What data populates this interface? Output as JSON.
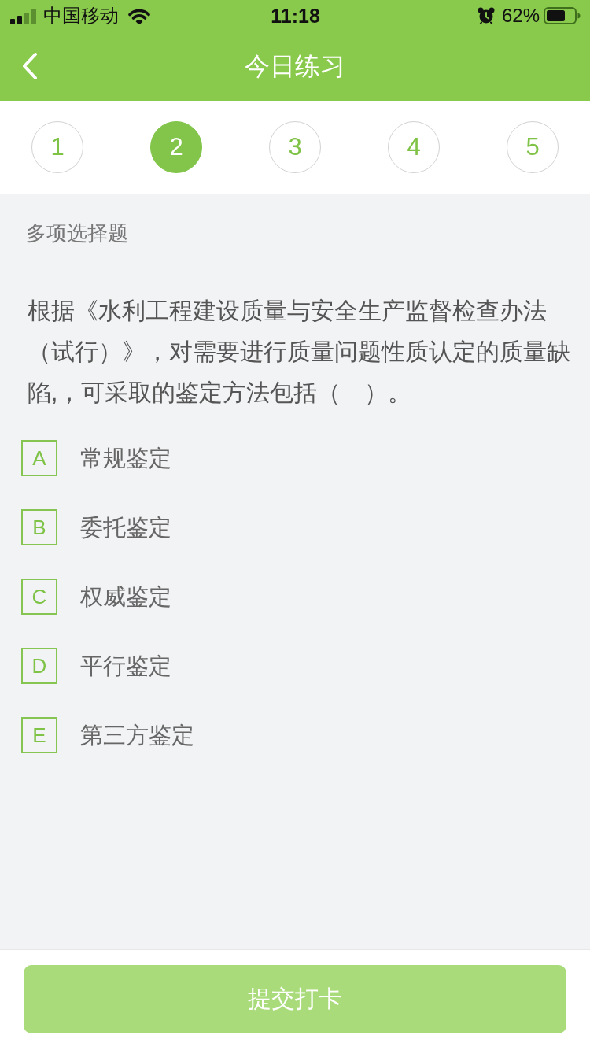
{
  "status_bar": {
    "carrier": "中国移动",
    "time": "11:18",
    "battery_percent": "62%"
  },
  "nav_bar": {
    "title": "今日练习"
  },
  "question_tabs": [
    {
      "label": "1",
      "selected": false
    },
    {
      "label": "2",
      "selected": true
    },
    {
      "label": "3",
      "selected": false
    },
    {
      "label": "4",
      "selected": false
    },
    {
      "label": "5",
      "selected": false
    }
  ],
  "question": {
    "type": "多项选择题",
    "text": "根据《水利工程建设质量与安全生产监督检查办法（试行）》，对需要进行质量问题性质认定的质量缺陷,，可采取的鉴定方法包括（　）。",
    "options": [
      {
        "letter": "A",
        "text": "常规鉴定",
        "selected": false
      },
      {
        "letter": "B",
        "text": "委托鉴定",
        "selected": false
      },
      {
        "letter": "C",
        "text": "权威鉴定",
        "selected": false
      },
      {
        "letter": "D",
        "text": "平行鉴定",
        "selected": false
      },
      {
        "letter": "E",
        "text": "第三方鉴定",
        "selected": false
      }
    ]
  },
  "submit_button": {
    "label": "提交打卡",
    "disabled": true
  }
}
